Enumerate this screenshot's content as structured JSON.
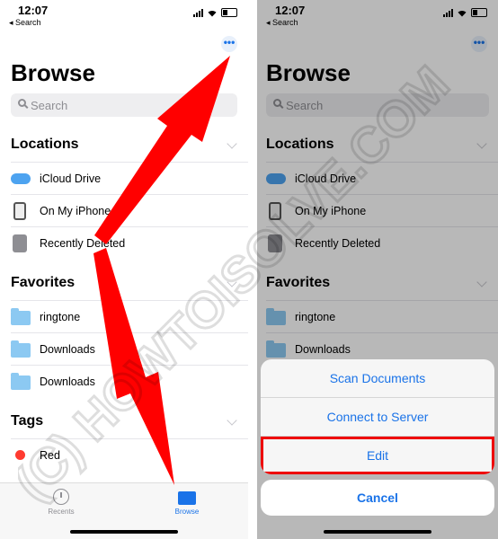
{
  "status": {
    "time": "12:07",
    "back": "◂ Search"
  },
  "more_glyph": "•••",
  "title": "Browse",
  "search_placeholder": "Search",
  "sections": {
    "locations": "Locations",
    "favorites": "Favorites",
    "tags": "Tags"
  },
  "locations": [
    {
      "label": "iCloud Drive",
      "icon": "icloud-icon"
    },
    {
      "label": "On My iPhone",
      "icon": "iphone-icon"
    },
    {
      "label": "Recently Deleted",
      "icon": "trash-icon"
    }
  ],
  "favorites": [
    {
      "label": "ringtone",
      "icon": "folder-icon"
    },
    {
      "label": "Downloads",
      "icon": "folder-icon"
    },
    {
      "label": "Downloads",
      "icon": "folder-icon"
    }
  ],
  "tags": [
    {
      "label": "Red",
      "color": "#ff3b30"
    }
  ],
  "tabbar": {
    "recents": "Recents",
    "browse": "Browse"
  },
  "action_sheet": {
    "scan": "Scan Documents",
    "connect": "Connect to Server",
    "edit": "Edit",
    "cancel": "Cancel"
  },
  "watermark": "(C) HOWTOISOLVE.COM",
  "colors": {
    "accent": "#1a73e8",
    "highlight": "#e00000",
    "arrow": "#ff0000"
  }
}
